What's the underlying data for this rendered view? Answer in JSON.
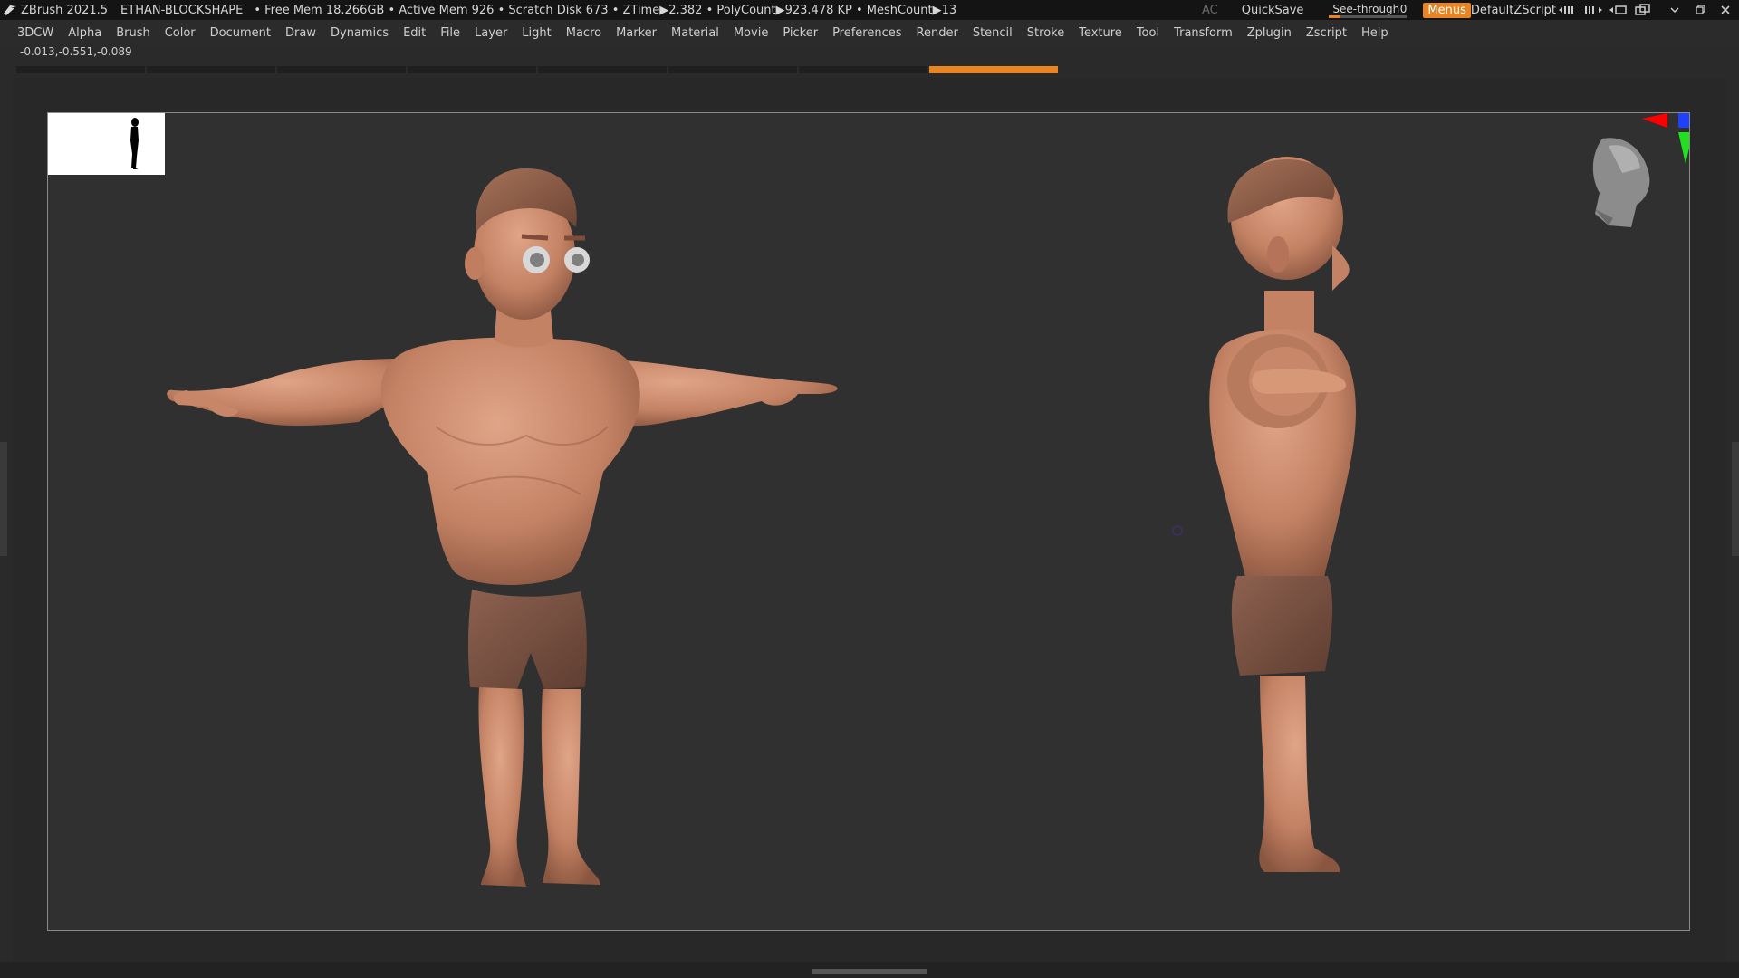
{
  "titlebar": {
    "app": "ZBrush 2021.5",
    "document": "ETHAN-BLOCKSHAPE",
    "stats": "• Free Mem 18.266GB • Active Mem 926 • Scratch Disk 673 • ZTime▶2.382 • PolyCount▶923.478 KP • MeshCount▶13",
    "ac": "AC",
    "quicksave": "QuickSave",
    "see_through_label": "See-through",
    "see_through_value": "0",
    "see_through_level": 0.15,
    "menus": "Menus",
    "script": "DefaultZScript"
  },
  "menubar": {
    "items": [
      "3DCW",
      "Alpha",
      "Brush",
      "Color",
      "Document",
      "Draw",
      "Dynamics",
      "Edit",
      "File",
      "Layer",
      "Light",
      "Macro",
      "Marker",
      "Material",
      "Movie",
      "Picker",
      "Preferences",
      "Render",
      "Stencil",
      "Stroke",
      "Texture",
      "Tool",
      "Transform",
      "Zplugin",
      "Zscript",
      "Help"
    ]
  },
  "status": {
    "coords": "-0.013,-0.551,-0.089"
  },
  "colors": {
    "accent": "#e88421",
    "skin": "#c9886a",
    "shorts": "#7a5242",
    "bg": "#303030"
  }
}
